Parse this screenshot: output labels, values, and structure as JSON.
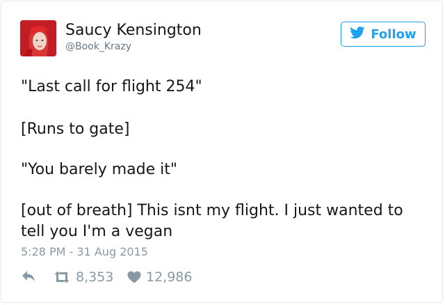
{
  "author": {
    "display_name": "Saucy Kensington",
    "handle": "@Book_Krazy"
  },
  "follow_button": {
    "label": "Follow"
  },
  "tweet": {
    "lines": [
      "\"Last call for flight 254\"",
      "[Runs to gate]",
      "\"You barely made it\"",
      "[out of breath] This isnt my flight. I just wanted to",
      "tell you I'm a vegan"
    ],
    "timestamp": "5:28 PM - 31 Aug 2015"
  },
  "stats": {
    "retweets": "8,353",
    "likes": "12,986"
  },
  "colors": {
    "accent": "#1da1f2",
    "muted": "#8899a6",
    "text": "#14171a"
  },
  "icons": {
    "follow": "twitter-bird-icon",
    "reply": "reply-icon",
    "retweet": "retweet-icon",
    "like": "heart-icon"
  }
}
